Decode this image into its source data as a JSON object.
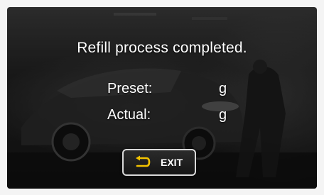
{
  "dialog": {
    "message": "Refill process completed.",
    "preset": {
      "label": "Preset:",
      "unit": "g"
    },
    "actual": {
      "label": "Actual:",
      "unit": "g"
    }
  },
  "exit_button": {
    "label": "EXIT",
    "icon": "return-arrow-icon",
    "icon_color": "#f2c200"
  },
  "colors": {
    "text": "#ffffff",
    "button_border": "#d9d9d9",
    "background": "#1b1b1b"
  }
}
